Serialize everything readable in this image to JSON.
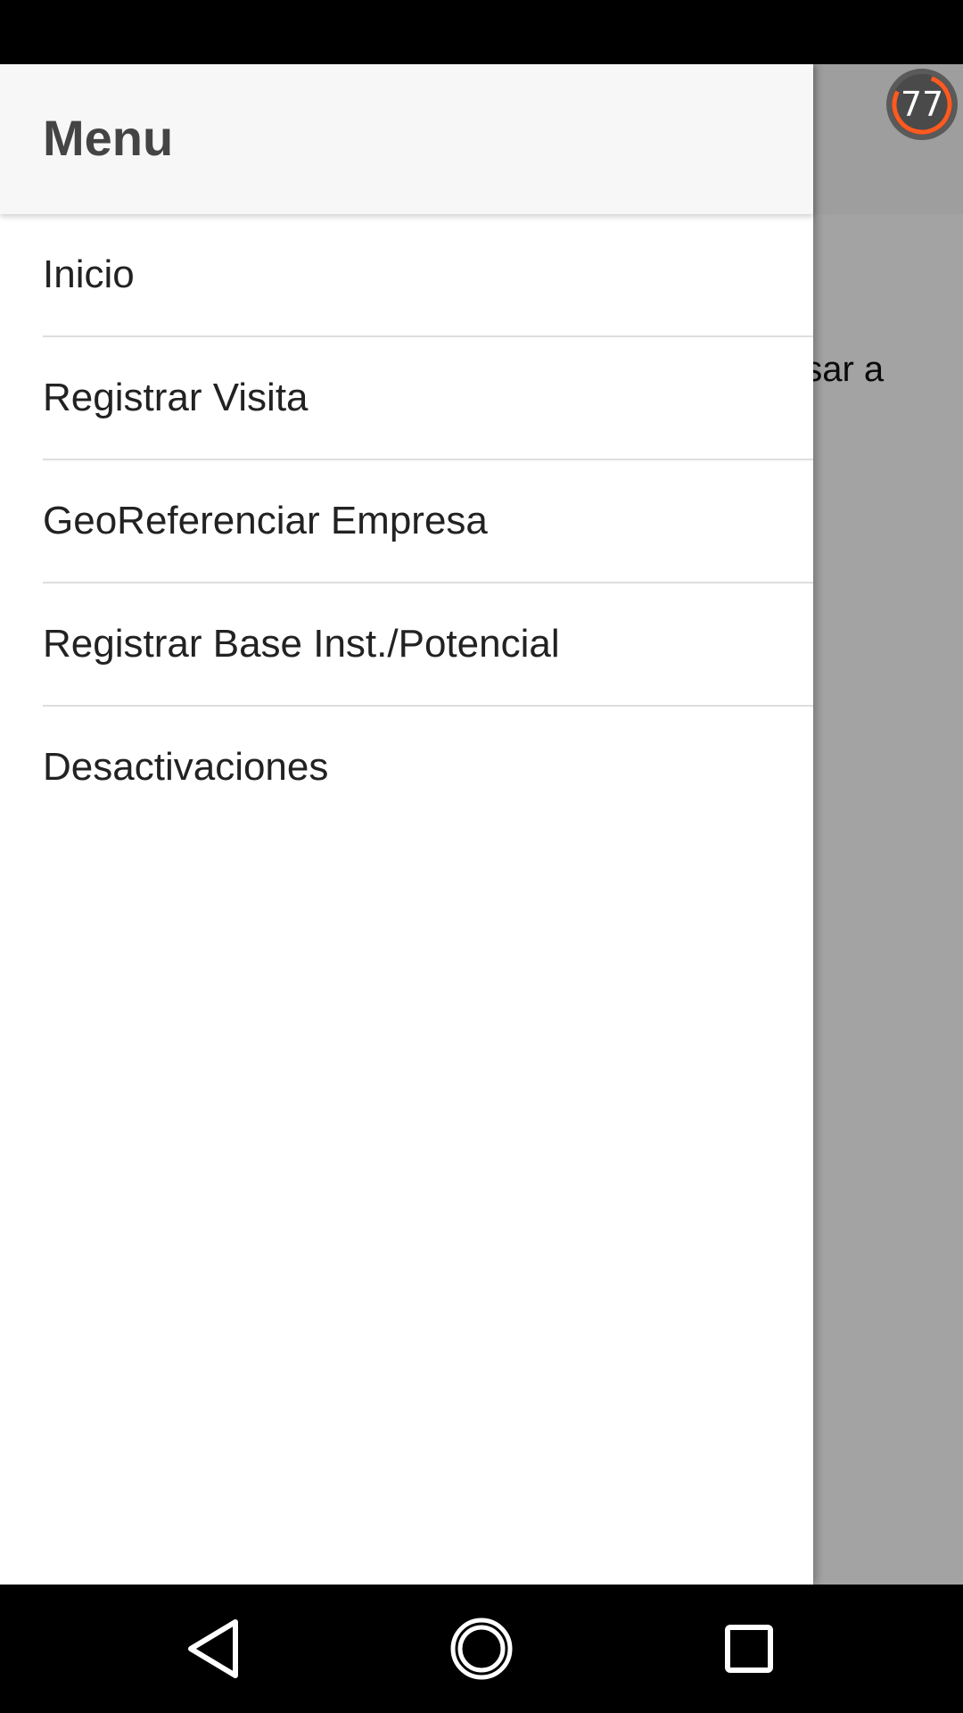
{
  "background_content": {
    "visible_text": "esar a"
  },
  "score_badge": {
    "value": "77",
    "accent_color": "#ff5a1f",
    "ring_color": "#555555"
  },
  "drawer": {
    "title": "Menu",
    "items": [
      {
        "label": "Inicio"
      },
      {
        "label": "Registrar Visita"
      },
      {
        "label": "GeoReferenciar Empresa"
      },
      {
        "label": "Registrar Base Inst./Potencial"
      },
      {
        "label": "Desactivaciones"
      }
    ]
  },
  "nav_bar": {
    "back_icon": "back-triangle-icon",
    "home_icon": "home-circle-icon",
    "recents_icon": "recents-square-icon"
  }
}
